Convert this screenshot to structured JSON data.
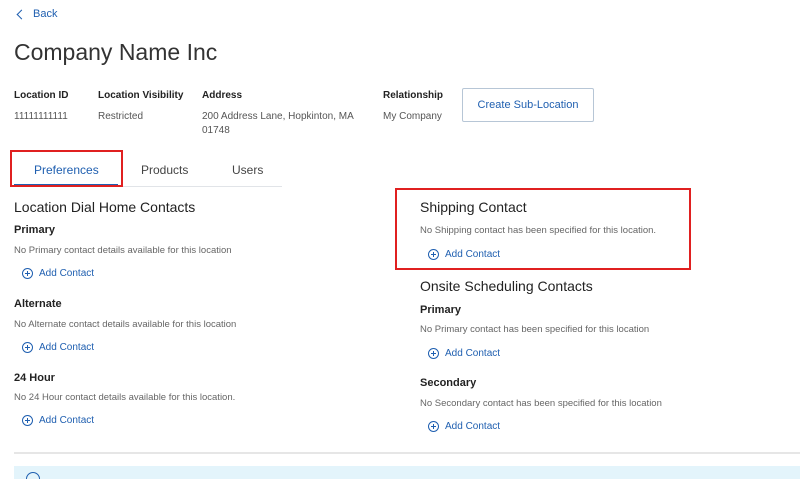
{
  "nav": {
    "back_label": "Back"
  },
  "page": {
    "title": "Company Name Inc"
  },
  "info": {
    "location_id_label": "Location ID",
    "location_id_value": "11111111111",
    "visibility_label": "Location Visibility",
    "visibility_value": "Restricted",
    "address_label": "Address",
    "address_line1": "200 Address Lane, Hopkinton, MA",
    "address_line2": "01748",
    "relationship_label": "Relationship",
    "relationship_value": "My Company"
  },
  "actions": {
    "create_sub_location": "Create Sub-Location"
  },
  "tabs": [
    {
      "label": "Preferences",
      "active": true
    },
    {
      "label": "Products",
      "active": false
    },
    {
      "label": "Users",
      "active": false
    }
  ],
  "dial_home": {
    "title": "Location Dial Home Contacts",
    "primary": {
      "label": "Primary",
      "desc": "No Primary contact details available for this location",
      "action": "Add Contact"
    },
    "alternate": {
      "label": "Alternate",
      "desc": "No Alternate contact details available for this location",
      "action": "Add Contact"
    },
    "hour24": {
      "label": "24 Hour",
      "desc": "No 24 Hour contact details available for this location.",
      "action": "Add Contact"
    }
  },
  "shipping": {
    "title": "Shipping Contact",
    "desc": "No Shipping contact has been specified for this location.",
    "action": "Add Contact"
  },
  "onsite": {
    "title": "Onsite Scheduling Contacts",
    "primary": {
      "label": "Primary",
      "desc": "No Primary contact has been specified for this location",
      "action": "Add Contact"
    },
    "secondary": {
      "label": "Secondary",
      "desc": "No Secondary contact has been specified for this location",
      "action": "Add Contact"
    }
  },
  "colors": {
    "accent": "#1f5fb0",
    "highlight": "#e02020",
    "banner": "#e3f4fb"
  },
  "icons": {
    "back": "chevron-left-icon",
    "add": "plus-circle-icon",
    "info": "info-icon"
  }
}
